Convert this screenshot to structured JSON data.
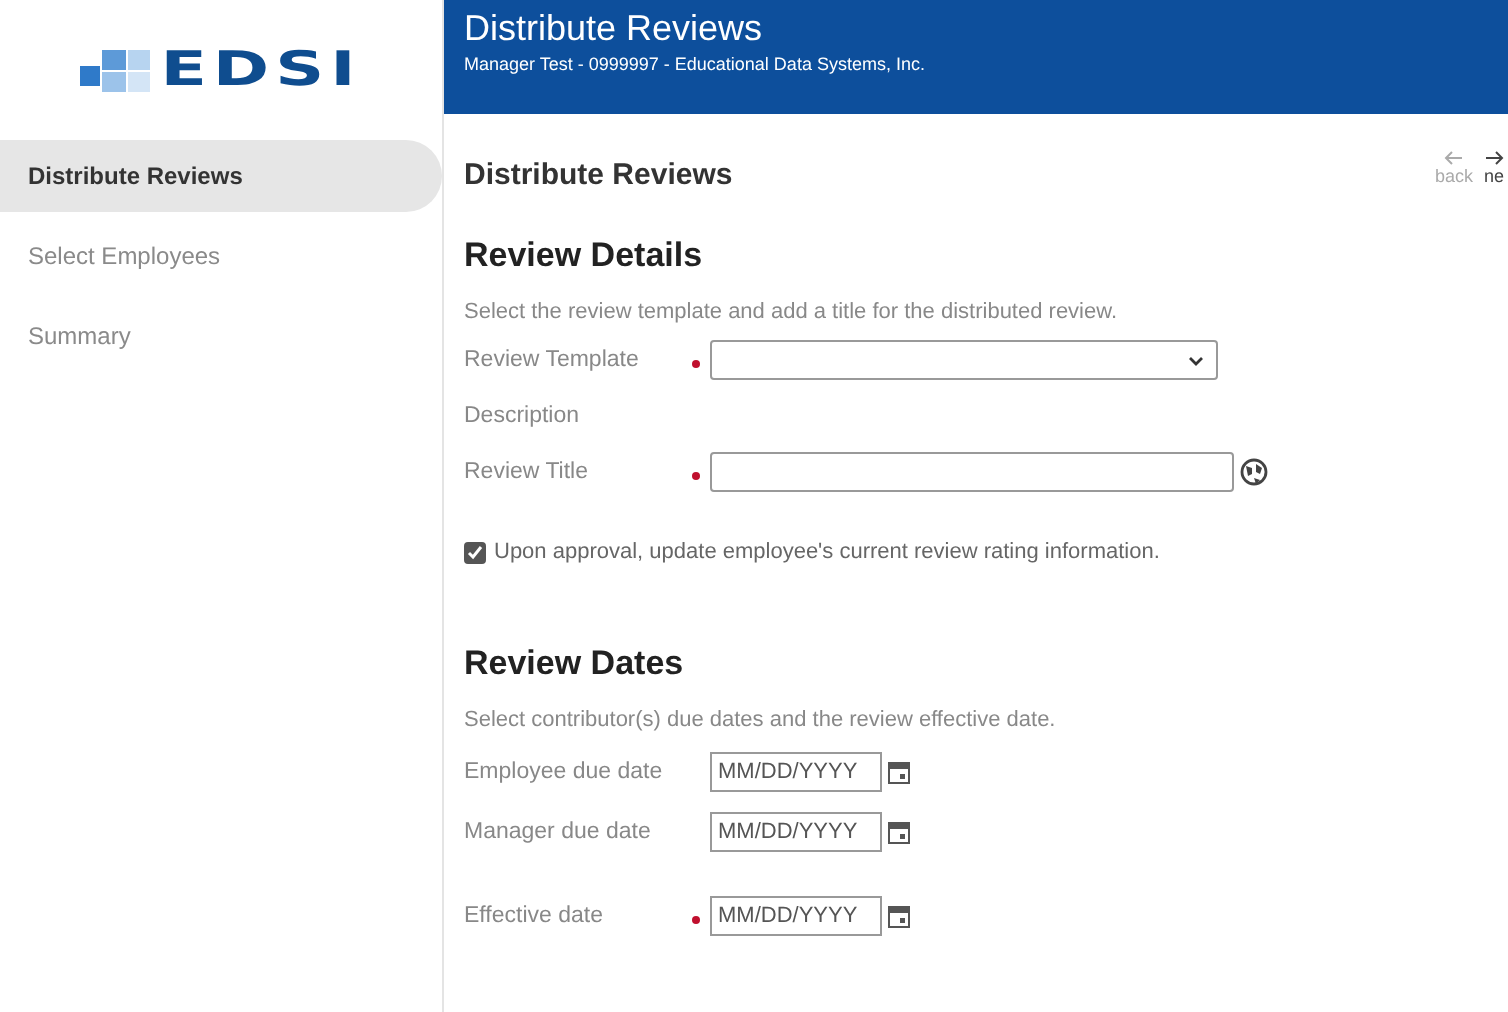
{
  "logo": {
    "text": "EDSI"
  },
  "sidebar": {
    "items": [
      {
        "label": "Distribute Reviews",
        "selected": true
      },
      {
        "label": "Select Employees",
        "selected": false
      },
      {
        "label": "Summary",
        "selected": false
      }
    ]
  },
  "header": {
    "title": "Distribute Reviews",
    "subtitle": "Manager Test - 0999997 - Educational Data Systems, Inc."
  },
  "page_title": "Distribute Reviews",
  "nav": {
    "back": {
      "label": "back"
    },
    "next": {
      "label": "ne"
    }
  },
  "details": {
    "heading": "Review Details",
    "description": "Select the review template and add a title for the distributed review.",
    "fields": [
      {
        "label": "Review Template",
        "kind": "select",
        "required": true
      },
      {
        "label": "Description",
        "kind": "static",
        "required": false
      },
      {
        "label": "Review Title",
        "kind": "text-globe",
        "required": true
      }
    ],
    "checkbox": {
      "label": "Upon approval, update employee's current review rating information.",
      "checked": true
    }
  },
  "dates": {
    "heading": "Review Dates",
    "description": "Select contributor(s) due dates and the review effective date.",
    "fields": [
      {
        "label": "Employee due date",
        "placeholder": "MM/DD/YYYY",
        "required": false
      },
      {
        "label": "Manager due date",
        "placeholder": "MM/DD/YYYY",
        "required": false
      },
      {
        "label": "Effective date",
        "placeholder": "MM/DD/YYYY",
        "required": true
      }
    ]
  }
}
